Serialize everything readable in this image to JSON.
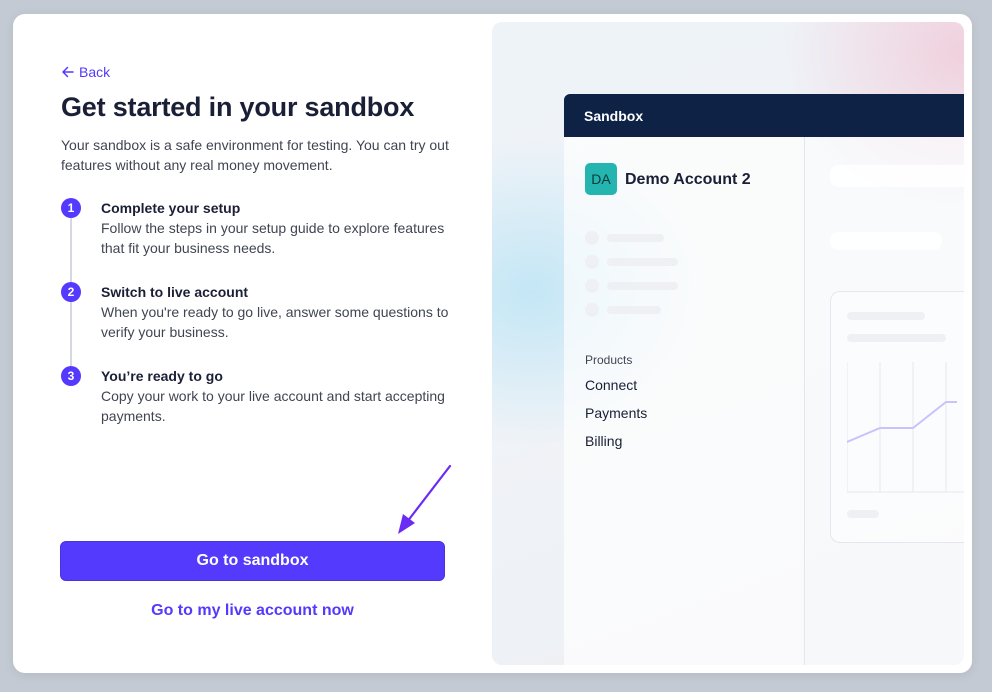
{
  "back_label": "Back",
  "title": "Get started in your sandbox",
  "subtitle": "Your sandbox is a safe environment for testing. You can try out features without any real money movement.",
  "steps": [
    {
      "number": "1",
      "title": "Complete your setup",
      "description": "Follow the steps in your setup guide to explore features that fit your business needs."
    },
    {
      "number": "2",
      "title": "Switch to live account",
      "description": "When you're ready to go live, answer some questions to verify your business."
    },
    {
      "number": "3",
      "title": "You’re ready to go",
      "description": "Copy your work to your live account and start accepting payments."
    }
  ],
  "primary_button": "Go to sandbox",
  "secondary_link": "Go to my live account now",
  "preview": {
    "header_title": "Sandbox",
    "avatar_initials": "DA",
    "account_name": "Demo Account 2",
    "products_label": "Products",
    "products": [
      "Connect",
      "Payments",
      "Billing"
    ]
  },
  "colors": {
    "accent": "#533afd",
    "header": "#0e2246",
    "avatar": "#24b5b0",
    "text": "#1a1f36"
  },
  "icons": {
    "back": "arrow-left-icon",
    "annotation": "purple-arrow-pointer"
  }
}
